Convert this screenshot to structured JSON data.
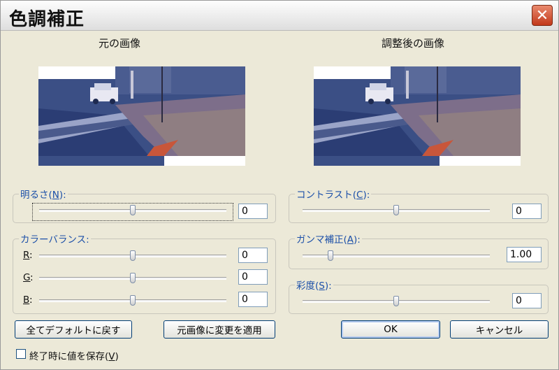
{
  "window": {
    "title": "色調補正"
  },
  "images": {
    "original_label": "元の画像",
    "adjusted_label": "調整後の画像"
  },
  "brightness": {
    "label": "明るさ(",
    "mnemonic": "N",
    "suffix": "):",
    "value": "0",
    "level": 0.5
  },
  "contrast": {
    "label": "コントラスト(",
    "mnemonic": "C",
    "suffix": "):",
    "value": "0",
    "level": 0.5
  },
  "color_balance": {
    "label": "カラーバランス:",
    "channels": [
      {
        "label": "R",
        "suffix": ":",
        "value": "0",
        "level": 0.5
      },
      {
        "label": "G",
        "suffix": ":",
        "value": "0",
        "level": 0.5
      },
      {
        "label": "B",
        "suffix": ":",
        "value": "0",
        "level": 0.5
      }
    ]
  },
  "gamma": {
    "label": "ガンマ補正(",
    "mnemonic": "A",
    "suffix": "):",
    "value": "1.00",
    "level": 0.15
  },
  "saturation": {
    "label": "彩度(",
    "mnemonic": "S",
    "suffix": "):",
    "value": "0",
    "level": 0.5
  },
  "buttons": {
    "reset_all": "全てデフォルトに戻す",
    "apply_original": "元画像に変更を適用",
    "ok": "OK",
    "cancel": "キャンセル"
  },
  "save_on_exit": {
    "label": "終了時に値を保存(",
    "mnemonic": "V",
    "suffix": ")",
    "checked": false
  }
}
